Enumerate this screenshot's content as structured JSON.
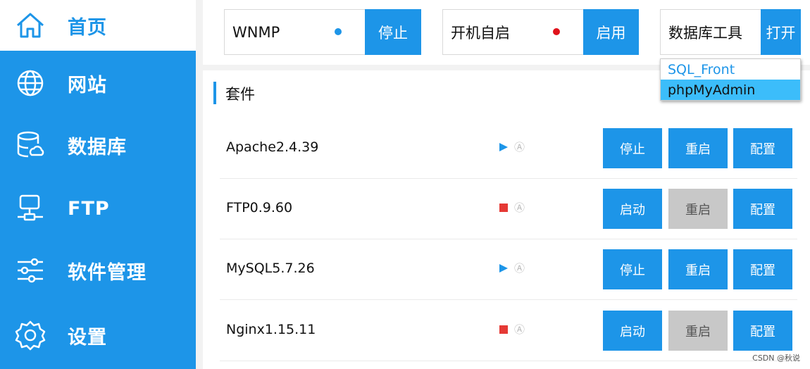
{
  "sidebar": {
    "items": [
      {
        "label": "首页",
        "icon": "home-icon",
        "active": true
      },
      {
        "label": "网站",
        "icon": "globe-icon"
      },
      {
        "label": "数据库",
        "icon": "database-icon"
      },
      {
        "label": "FTP",
        "icon": "network-icon"
      },
      {
        "label": "软件管理",
        "icon": "sliders-icon"
      },
      {
        "label": "设置",
        "icon": "gear-icon"
      }
    ]
  },
  "topbar": {
    "wnmp": {
      "label": "WNMP",
      "button": "停止",
      "dot_color": "#1d95e8"
    },
    "autostart": {
      "label": "开机自启",
      "button": "启用",
      "dot_color": "#e0121b"
    },
    "dbtools": {
      "label": "数据库工具",
      "button": "打开"
    }
  },
  "dropdown": {
    "items": [
      "SQL_Front",
      "phpMyAdmin"
    ]
  },
  "suite": {
    "title": "套件",
    "auto_glyph": "Ⓐ",
    "services": [
      {
        "name": "Apache2.4.39",
        "state": "running",
        "primary": "停止",
        "restart": "重启",
        "config": "配置"
      },
      {
        "name": "FTP0.9.60",
        "state": "stopped",
        "primary": "启动",
        "restart": "重启",
        "config": "配置"
      },
      {
        "name": "MySQL5.7.26",
        "state": "running",
        "primary": "停止",
        "restart": "重启",
        "config": "配置"
      },
      {
        "name": "Nginx1.15.11",
        "state": "stopped",
        "primary": "启动",
        "restart": "重启",
        "config": "配置"
      }
    ]
  },
  "colors": {
    "accent": "#1d95e8",
    "running": "#1d95e8",
    "stopped": "#e53935",
    "disabled": "#c8c8c8"
  },
  "watermark": "CSDN @秋说"
}
